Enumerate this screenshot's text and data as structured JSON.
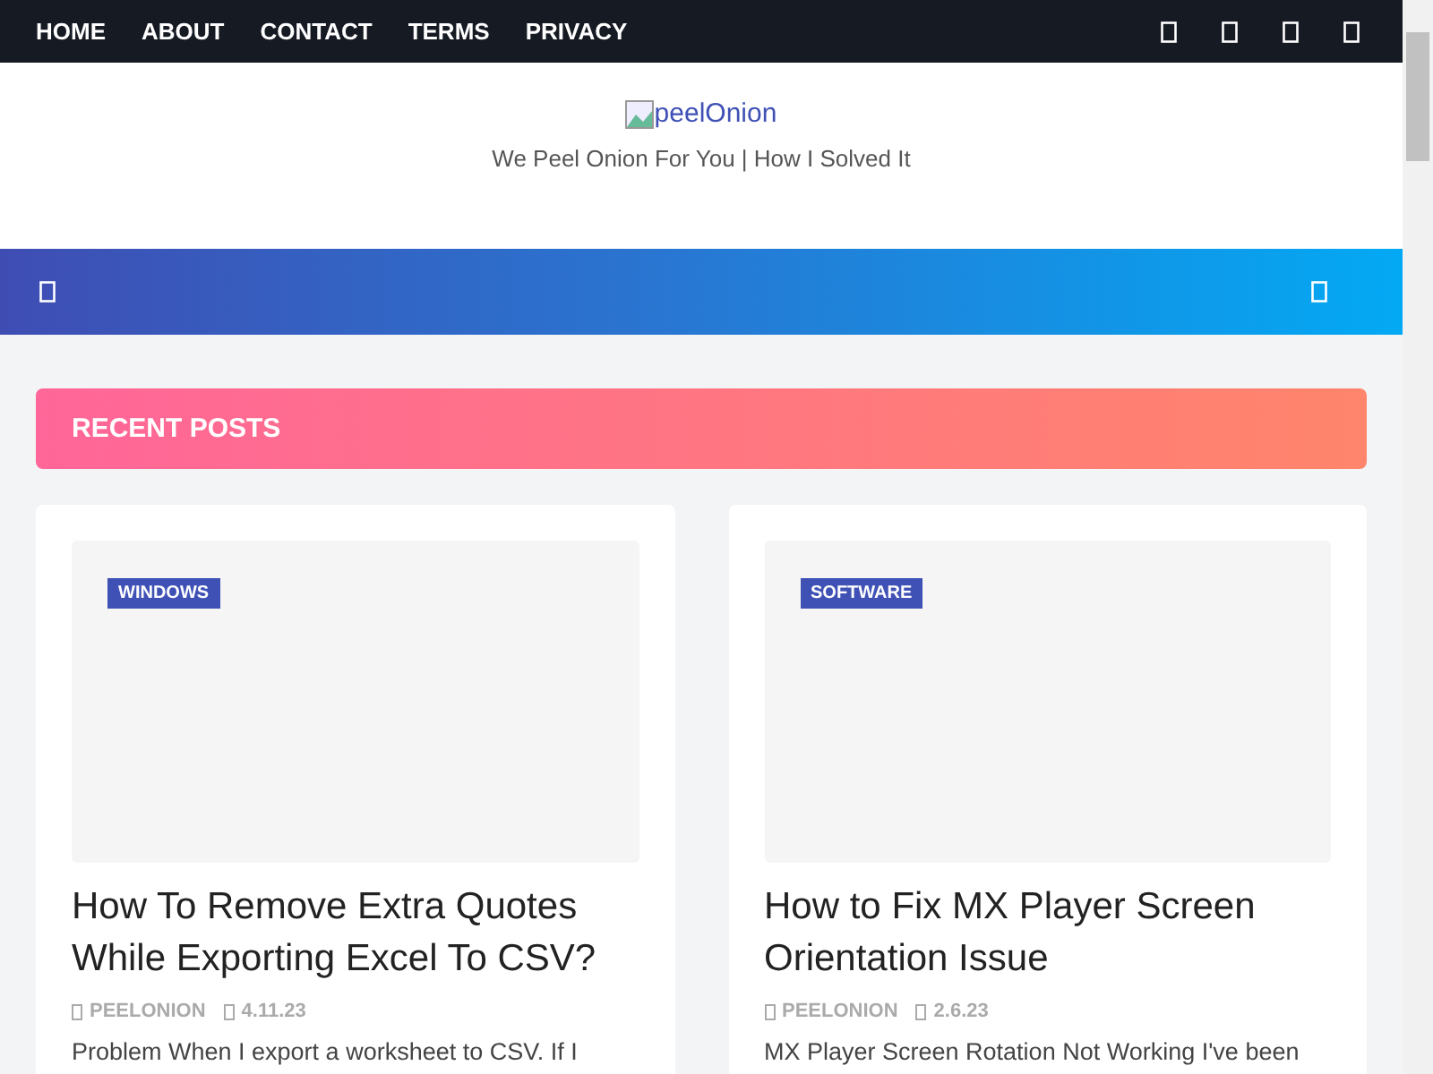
{
  "nav": {
    "links": [
      "HOME",
      "ABOUT",
      "CONTACT",
      "TERMS",
      "PRIVACY"
    ]
  },
  "header": {
    "logo_alt": "peelOnion",
    "tagline": "We Peel Onion For You | How I Solved It"
  },
  "section": {
    "title": "RECENT POSTS"
  },
  "posts": [
    {
      "category": "WINDOWS",
      "title": "How To Remove Extra Quotes While Exporting Excel To CSV?",
      "author": "PEELONION",
      "date": "4.11.23",
      "excerpt": "Problem When I export a worksheet to CSV. If I"
    },
    {
      "category": "SOFTWARE",
      "title": "How to Fix MX Player Screen Orientation Issue",
      "author": "PEELONION",
      "date": "2.6.23",
      "excerpt": "MX Player Screen Rotation Not Working I've been"
    }
  ]
}
